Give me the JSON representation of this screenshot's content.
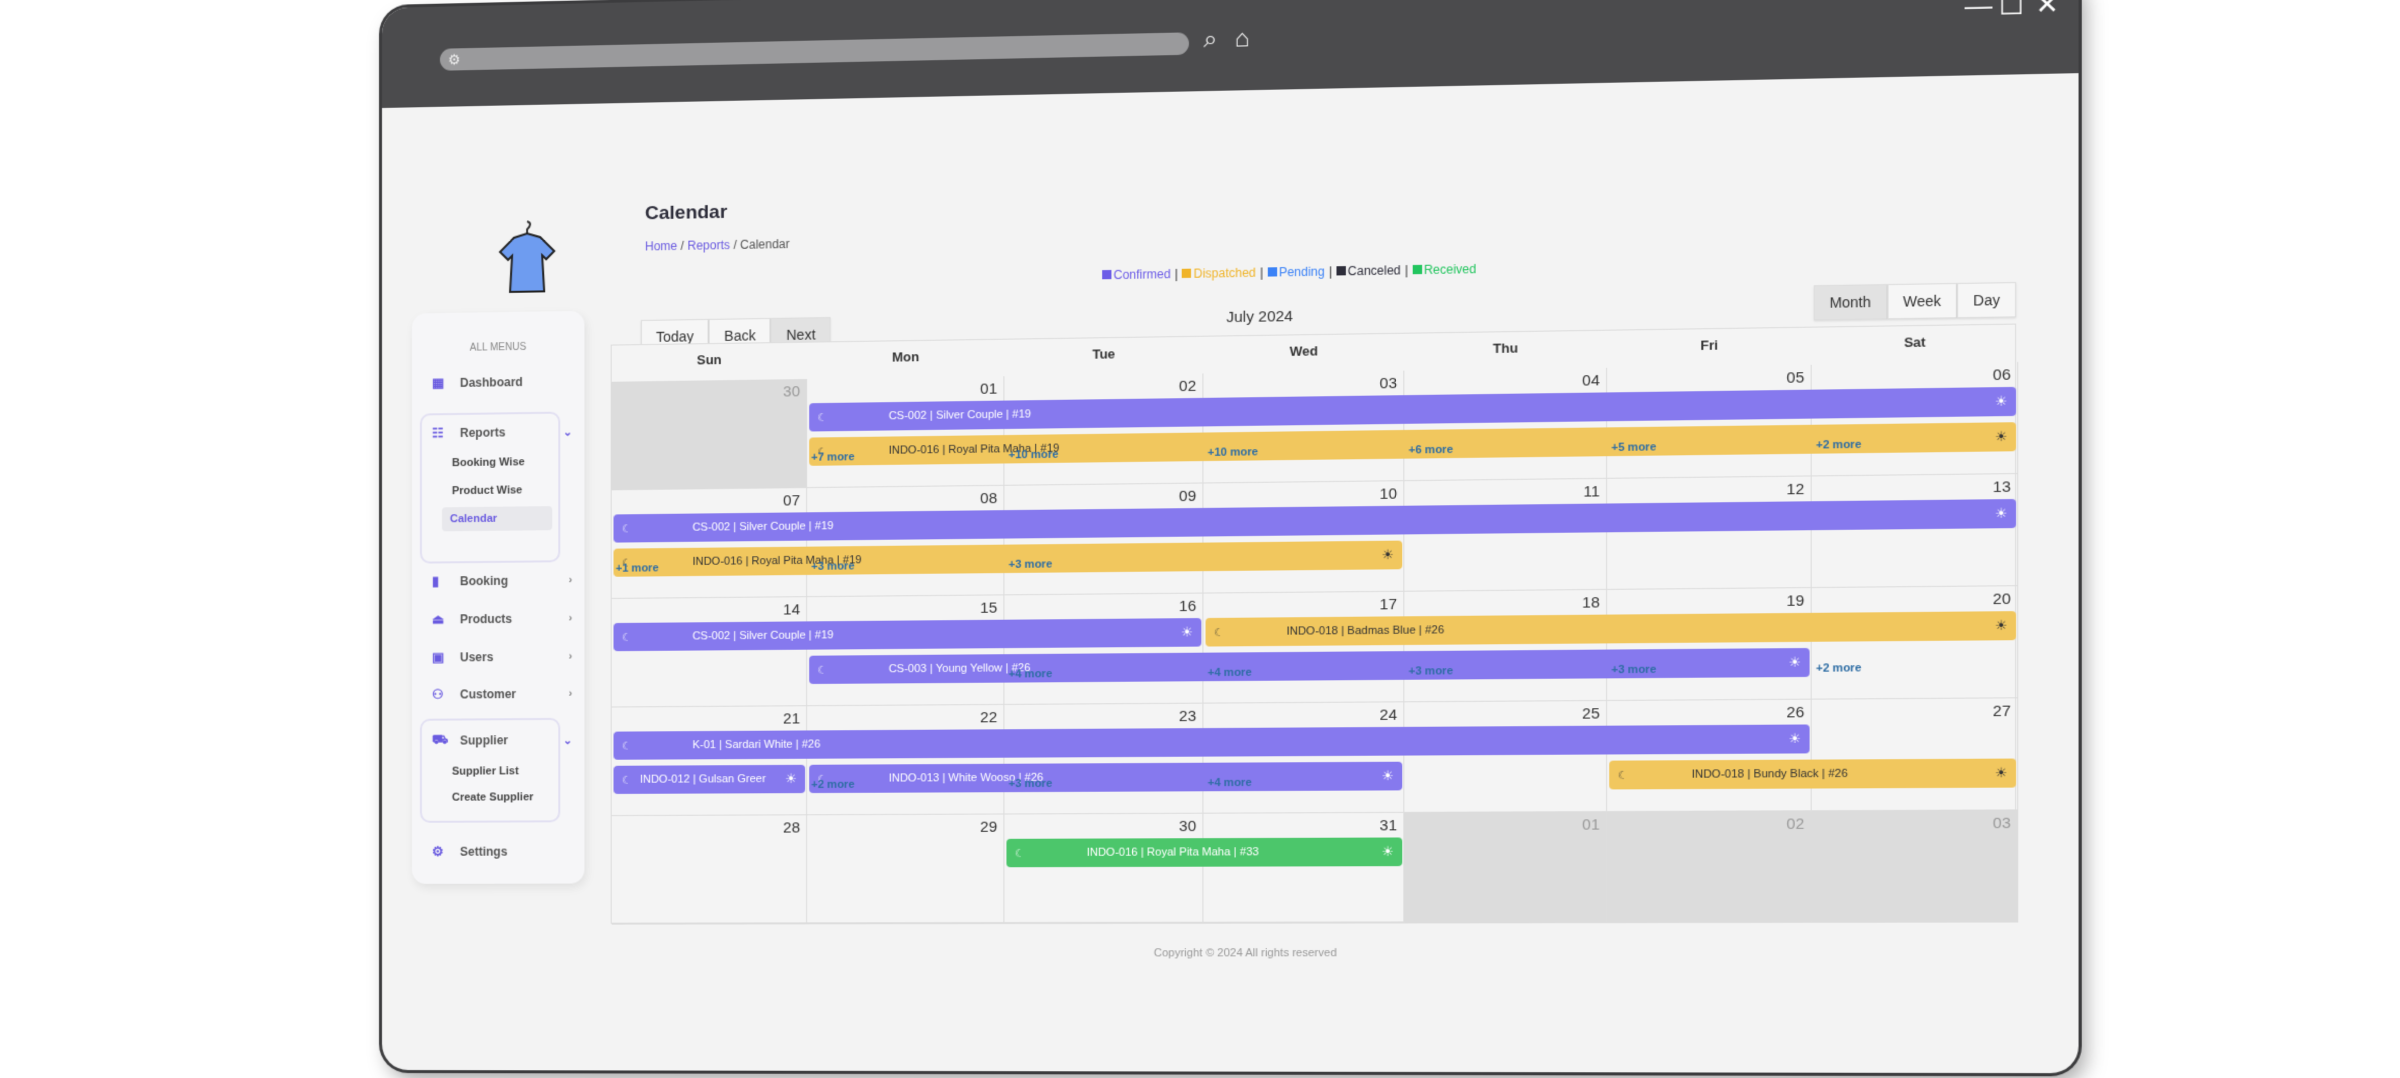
{
  "browser": {
    "controls": {
      "minimize": "—",
      "maximize": "☐",
      "close": "✕"
    }
  },
  "sidebar": {
    "heading": "ALL MENUS",
    "items": [
      {
        "label": "Dashboard",
        "icon": "dashboard-icon"
      },
      {
        "label": "Reports",
        "icon": "reports-icon",
        "expanded": true,
        "children": [
          "Booking Wise",
          "Product Wise",
          "Calendar"
        ],
        "active_child": "Calendar"
      },
      {
        "label": "Booking",
        "icon": "booking-icon"
      },
      {
        "label": "Products",
        "icon": "hanger-icon"
      },
      {
        "label": "Users",
        "icon": "user-badge-icon"
      },
      {
        "label": "Customer",
        "icon": "customers-icon"
      },
      {
        "label": "Supplier",
        "icon": "truck-icon",
        "expanded": true,
        "children": [
          "Supplier List",
          "Create Supplier"
        ]
      },
      {
        "label": "Settings",
        "icon": "gear-icon"
      }
    ]
  },
  "page": {
    "title": "Calendar",
    "breadcrumb": [
      "Home",
      "Reports",
      "Calendar"
    ]
  },
  "legend": [
    {
      "label": "Confirmed",
      "color": "#6c5ce7"
    },
    {
      "label": "Dispatched",
      "color": "#f0b429"
    },
    {
      "label": "Pending",
      "color": "#3b82f6"
    },
    {
      "label": "Canceled",
      "color": "#2d2d3a"
    },
    {
      "label": "Received",
      "color": "#22c55e"
    }
  ],
  "toolbar": {
    "today": "Today",
    "back": "Back",
    "next": "Next",
    "label": "July 2024",
    "views": [
      "Month",
      "Week",
      "Day"
    ],
    "active_view": "Month"
  },
  "calendar": {
    "weekdays": [
      "Sun",
      "Mon",
      "Tue",
      "Wed",
      "Thu",
      "Fri",
      "Sat"
    ],
    "weeks": [
      {
        "days": [
          "30",
          "01",
          "02",
          "03",
          "04",
          "05",
          "06"
        ],
        "off": [
          0
        ],
        "events": [
          {
            "label": "CS-002 | Silver Couple | #19",
            "status": "confirmed",
            "start": 1,
            "span": 6,
            "row": 0
          },
          {
            "label": "INDO-016 | Royal Pita Maha | #19",
            "status": "dispatched",
            "start": 1,
            "span": 6,
            "row": 1
          }
        ],
        "more": {
          "1": "+7 more",
          "2": "+10 more",
          "3": "+10 more",
          "4": "+6 more",
          "5": "+5 more",
          "6": "+2 more"
        }
      },
      {
        "days": [
          "07",
          "08",
          "09",
          "10",
          "11",
          "12",
          "13"
        ],
        "off": [],
        "events": [
          {
            "label": "CS-002 | Silver Couple | #19",
            "status": "confirmed",
            "start": 0,
            "span": 7,
            "row": 0
          },
          {
            "label": "INDO-016 | Royal Pita Maha | #19",
            "status": "dispatched",
            "start": 0,
            "span": 4,
            "row": 1
          }
        ],
        "more": {
          "0": "+1 more",
          "1": "+3 more",
          "2": "+3 more"
        }
      },
      {
        "days": [
          "14",
          "15",
          "16",
          "17",
          "18",
          "19",
          "20"
        ],
        "off": [],
        "events": [
          {
            "label": "CS-002 | Silver Couple | #19",
            "status": "confirmed",
            "start": 0,
            "span": 3,
            "row": 0
          },
          {
            "label": "INDO-018 | Badmas Blue | #26",
            "status": "dispatched",
            "start": 3,
            "span": 4,
            "row": 0
          },
          {
            "label": "CS-003 | Young Yellow | #26",
            "status": "confirmed",
            "start": 1,
            "span": 5,
            "row": 1
          }
        ],
        "more": {
          "2": "+4 more",
          "3": "+4 more",
          "4": "+3 more",
          "5": "+3 more",
          "6": "+2 more"
        }
      },
      {
        "days": [
          "21",
          "22",
          "23",
          "24",
          "25",
          "26",
          "27"
        ],
        "off": [],
        "events": [
          {
            "label": "K-01 | Sardari White | #26",
            "status": "confirmed",
            "start": 0,
            "span": 6,
            "row": 0
          },
          {
            "label": "INDO-012 | Gulsan Greer",
            "status": "confirmed",
            "start": 0,
            "span": 1,
            "row": 1
          },
          {
            "label": "INDO-013 | White Wooso | #26",
            "status": "confirmed",
            "start": 1,
            "span": 3,
            "row": 1
          },
          {
            "label": "INDO-018 | Bundy Black | #26",
            "status": "dispatched",
            "start": 5,
            "span": 2,
            "row": 1
          }
        ],
        "more": {
          "1": "+2 more",
          "2": "+3 more",
          "3": "+4 more"
        }
      },
      {
        "days": [
          "28",
          "29",
          "30",
          "31",
          "01",
          "02",
          "03"
        ],
        "off": [
          4,
          5,
          6
        ],
        "events": [
          {
            "label": "INDO-016 | Royal Pita Maha | #33",
            "status": "received",
            "start": 2,
            "span": 2,
            "row": 0
          }
        ],
        "more": {}
      }
    ]
  },
  "event_colors": {
    "confirmed": "#8679ee",
    "dispatched": "#f1c75e",
    "received": "#4cc66b"
  },
  "footer": {
    "text": "Copyright © 2024 All rights reserved"
  }
}
